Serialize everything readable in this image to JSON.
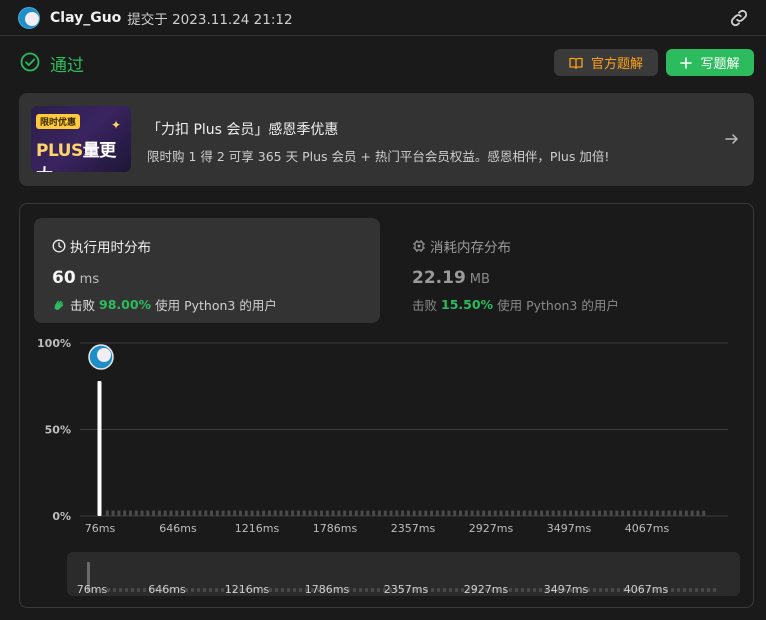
{
  "header": {
    "username": "Clay_Guo",
    "submit_info": "提交于 2023.11.24 21:12"
  },
  "status": {
    "text": "通过",
    "color": "#2cbb5d",
    "official_solution_label": "官方题解",
    "write_solution_label": "写题解"
  },
  "promo": {
    "tag": "限时优惠",
    "image_text_a": "PLUS",
    "image_text_b": "量更大",
    "title": "「力扣 Plus 会员」感恩季优惠",
    "subtitle": "限时购 1 得 2 可享 365 天 Plus 会员 + 热门平台会员权益。感恩相伴，Plus 加倍!"
  },
  "runtime": {
    "title": "执行用时分布",
    "value": "60",
    "unit": "ms",
    "beat_label": "击败",
    "beat_pct": "98.00%",
    "beat_suffix": "使用 Python3 的用户"
  },
  "memory": {
    "title": "消耗内存分布",
    "value": "22.19",
    "unit": "MB",
    "beat_label": "击败",
    "beat_pct": "15.50%",
    "beat_suffix": "使用 Python3 的用户"
  },
  "chart_data": {
    "type": "bar",
    "y_ticks": [
      "100%",
      "50%",
      "0%"
    ],
    "x_ticks": [
      "76ms",
      "646ms",
      "1216ms",
      "1786ms",
      "2357ms",
      "2927ms",
      "3497ms",
      "4067ms"
    ],
    "ylim": [
      0,
      100
    ],
    "highlight_bar": {
      "x": "76ms",
      "value": 78
    },
    "other_bars_value": 2,
    "grid": true
  },
  "scroller": {
    "x_ticks": [
      "76ms",
      "646ms",
      "1216ms",
      "1786ms",
      "2357ms",
      "2927ms",
      "3497ms",
      "4067ms"
    ]
  }
}
